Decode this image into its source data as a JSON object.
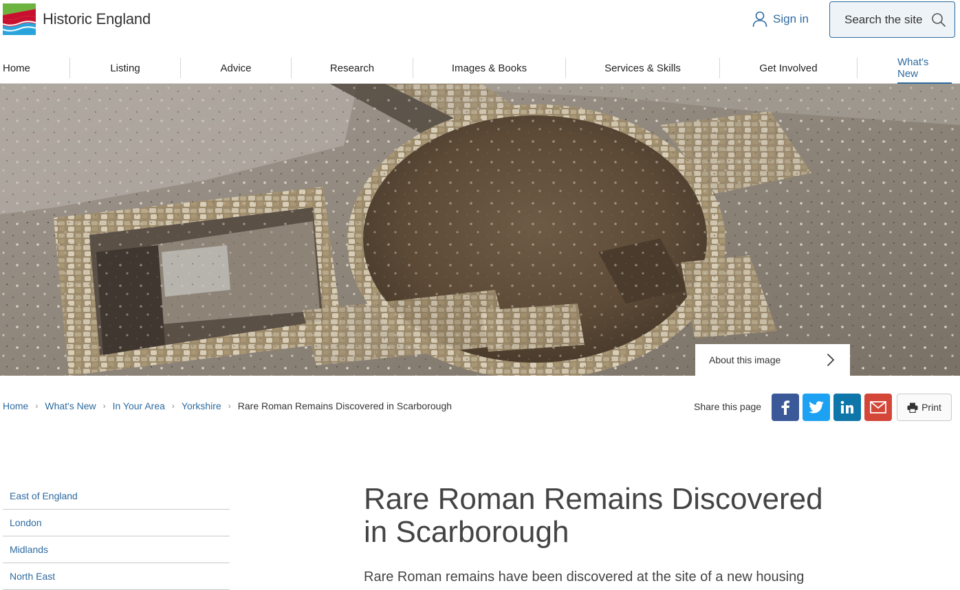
{
  "brand": {
    "name": "Historic England"
  },
  "header": {
    "signin_label": "Sign in",
    "search_label": "Search the site"
  },
  "nav": {
    "items": [
      {
        "label": "Home"
      },
      {
        "label": "Listing"
      },
      {
        "label": "Advice"
      },
      {
        "label": "Research"
      },
      {
        "label": "Images & Books"
      },
      {
        "label": "Services & Skills"
      },
      {
        "label": "Get Involved"
      },
      {
        "label": "What's New",
        "active": true
      }
    ]
  },
  "hero": {
    "about_label": "About this image"
  },
  "breadcrumb": {
    "items": [
      "Home",
      "What's New",
      "In Your Area",
      "Yorkshire"
    ],
    "current": "Rare Roman Remains Discovered in Scarborough"
  },
  "share": {
    "label": "Share this page",
    "print_label": "Print",
    "colors": {
      "facebook": "#3b5998",
      "twitter": "#1da1f2",
      "linkedin": "#0e76a8",
      "email": "#d44638"
    }
  },
  "sidebar": {
    "items": [
      "East of England",
      "London",
      "Midlands",
      "North East"
    ]
  },
  "article": {
    "title": "Rare Roman Remains Discovered in Scarborough",
    "lede": "Rare Roman remains have been discovered at the site of a new housing"
  },
  "theme": {
    "accent": "#2d6a9f",
    "text": "#333333"
  }
}
